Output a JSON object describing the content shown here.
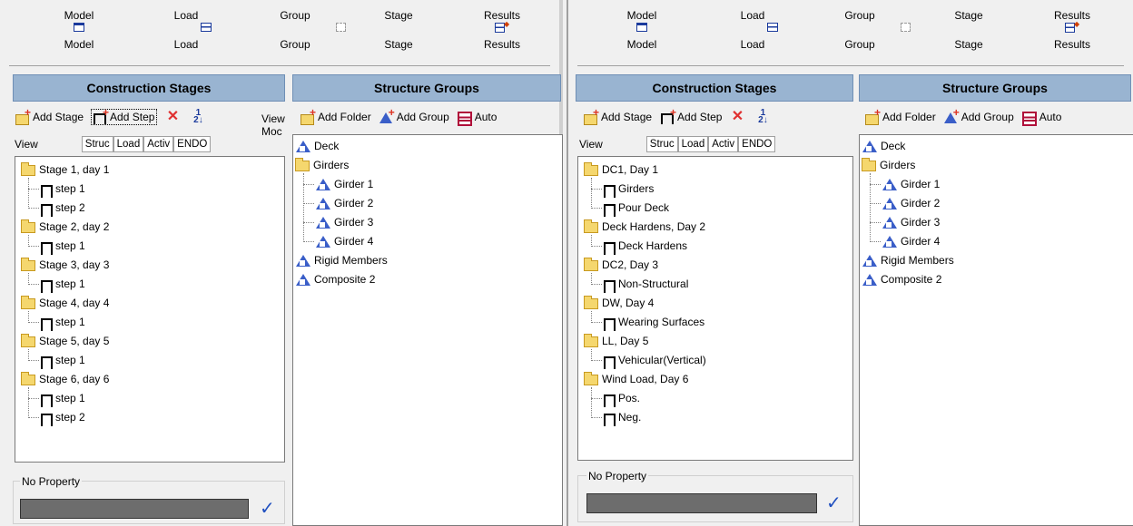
{
  "ribbon": {
    "top_labels": [
      "Model",
      "Load",
      "Group",
      "Stage",
      "Results"
    ],
    "bottom_labels": [
      "Model",
      "Load",
      "Group",
      "Stage",
      "Results"
    ]
  },
  "stages_panel": {
    "title": "Construction Stages",
    "add_stage": "Add Stage",
    "add_step": "Add Step",
    "view_label": "View",
    "columns": [
      "Struc",
      "Load",
      "Activ",
      "ENDO"
    ]
  },
  "groups_panel": {
    "title": "Structure Groups",
    "add_folder": "Add Folder",
    "add_group": "Add Group",
    "auto": "Auto",
    "view_mode_label": [
      "View",
      "Moc"
    ]
  },
  "property": {
    "label": "No Property"
  },
  "left": {
    "stages": [
      {
        "name": "Stage 1, day 1",
        "steps": [
          "step 1",
          "step 2"
        ]
      },
      {
        "name": "Stage 2, day 2",
        "steps": [
          "step 1"
        ]
      },
      {
        "name": "Stage 3, day 3",
        "steps": [
          "step 1"
        ]
      },
      {
        "name": "Stage 4, day 4",
        "steps": [
          "step 1"
        ]
      },
      {
        "name": "Stage 5, day 5",
        "steps": [
          "step 1"
        ]
      },
      {
        "name": "Stage 6, day 6",
        "steps": [
          "step 1",
          "step 2"
        ]
      }
    ]
  },
  "right": {
    "stages": [
      {
        "name": "DC1, Day 1",
        "steps": [
          "Girders",
          "Pour Deck"
        ]
      },
      {
        "name": "Deck Hardens, Day 2",
        "steps": [
          "Deck Hardens"
        ]
      },
      {
        "name": "DC2, Day 3",
        "steps": [
          "Non-Structural"
        ]
      },
      {
        "name": "DW, Day 4",
        "steps": [
          "Wearing Surfaces"
        ]
      },
      {
        "name": "LL, Day 5",
        "steps": [
          "Vehicular(Vertical)"
        ]
      },
      {
        "name": "Wind Load, Day 6",
        "steps": [
          "Pos.",
          "Neg."
        ]
      }
    ]
  },
  "groups": {
    "items": [
      "Deck",
      "Girders",
      "Girder 1",
      "Girder 2",
      "Girder 3",
      "Girder 4",
      "Rigid Members",
      "Composite 2"
    ]
  },
  "icons": {
    "folder": "folder-icon",
    "step": "step-icon",
    "group": "structure-group-icon",
    "delete": "delete-icon",
    "sort": "sort-icon",
    "confirm": "checkmark-icon"
  },
  "colors": {
    "panel_header": "#99b4d1",
    "folder": "#f5d76e",
    "group": "#3a5ec8",
    "delete": "#e03030"
  }
}
